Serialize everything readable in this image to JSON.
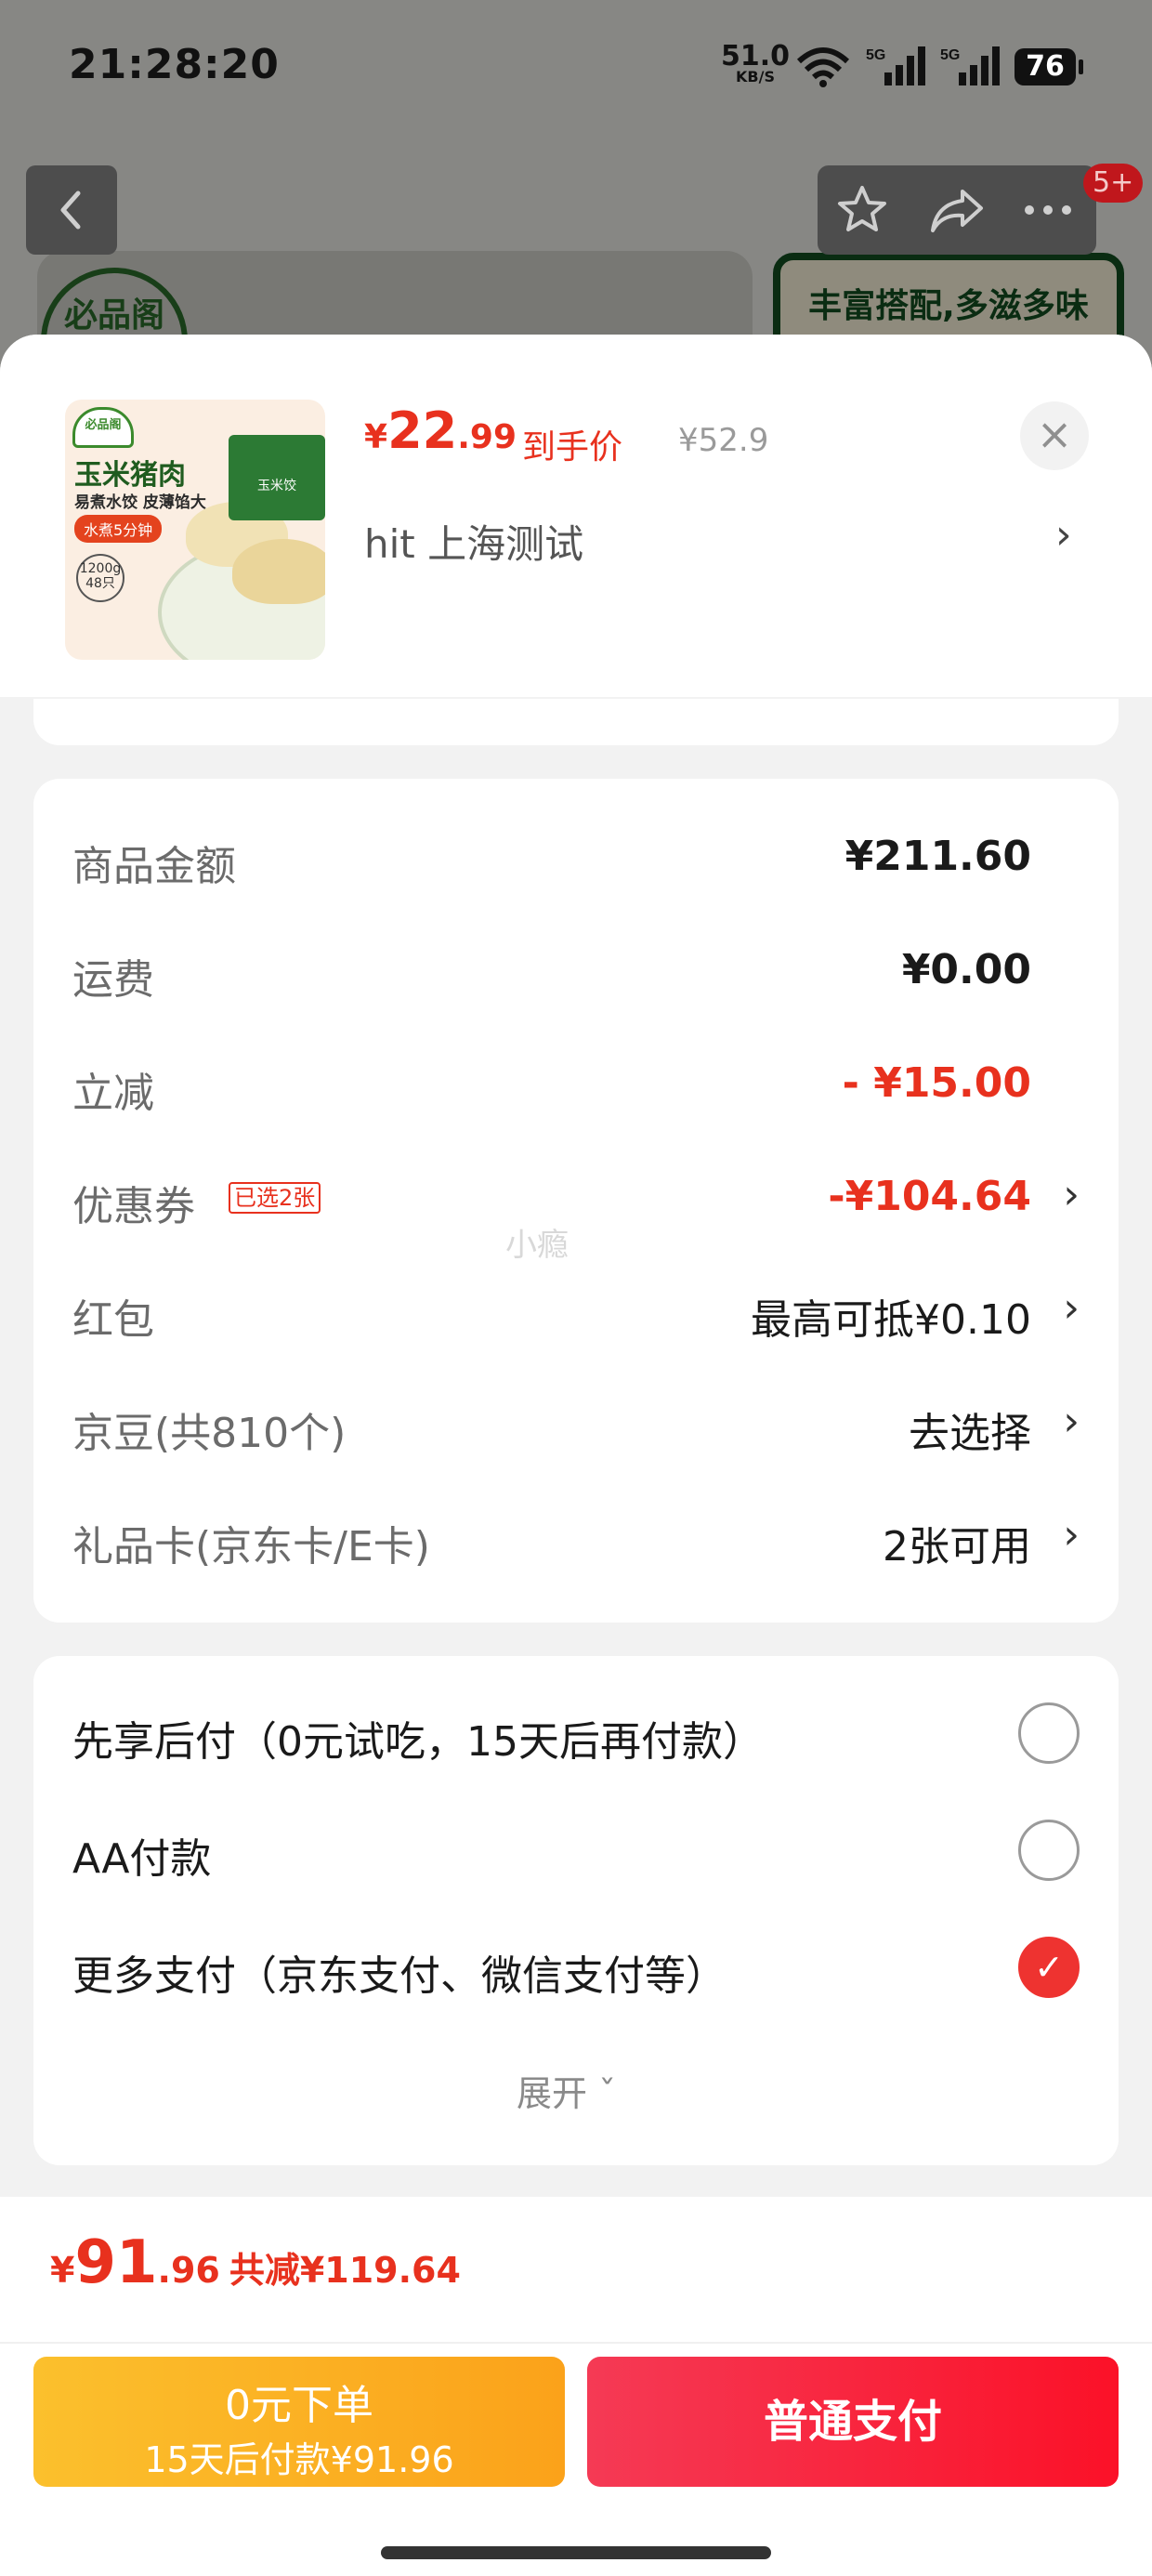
{
  "status_bar": {
    "time": "21:28:20",
    "net_speed": "51.0",
    "net_unit": "KB/S",
    "sig1": "5G",
    "sig2": "5G",
    "battery": "76"
  },
  "background": {
    "badge": "5+",
    "logo": "必品阁",
    "banner": "丰富搭配,多滋多味"
  },
  "product": {
    "thumb_logo": "必品阁",
    "thumb_title": "玉米猪肉",
    "thumb_sub": "易煮水饺 皮薄馅大",
    "thumb_tag": "水煮5分钟",
    "thumb_weight": "1200g",
    "thumb_count": "48只",
    "thumb_pkg": "玉米饺",
    "price_currency": "¥",
    "price_int": "22",
    "price_dec": ".99",
    "price_label": "到手价",
    "orig_price": "¥52.9",
    "address": "hit  上海测试"
  },
  "amounts": {
    "rows": [
      {
        "label": "商品金额",
        "value": "¥211.60"
      },
      {
        "label": "运费",
        "value": "¥0.00"
      },
      {
        "label": "立减",
        "value": "- ¥15.00"
      },
      {
        "label": "优惠券",
        "tag": "已选2张",
        "value": "-¥104.64"
      },
      {
        "label": "红包",
        "value": "最高可抵¥0.10"
      },
      {
        "label": "京豆(共810个)",
        "value": "去选择"
      },
      {
        "label": "礼品卡(京东卡/E卡)",
        "value": "2张可用"
      }
    ],
    "watermark": "小瘾"
  },
  "payment": {
    "options": [
      {
        "label": "先享后付（0元试吃，15天后再付款）",
        "selected": false
      },
      {
        "label": "AA付款",
        "selected": false
      },
      {
        "label": "更多支付（京东支付、微信支付等）",
        "selected": true
      }
    ],
    "expand_label": "展开 ˇ"
  },
  "footer": {
    "currency": "¥",
    "total_int": "91",
    "total_dec": ".96",
    "save_text": "共减¥119.64",
    "zero_btn_line1": "0元下单",
    "zero_btn_line2": "15天后付款¥91.96",
    "pay_btn": "普通支付"
  },
  "colors": {
    "accent_red": "#e8311e",
    "pay_red": "#fb1128",
    "zero_yellow": "#fbc02d"
  }
}
